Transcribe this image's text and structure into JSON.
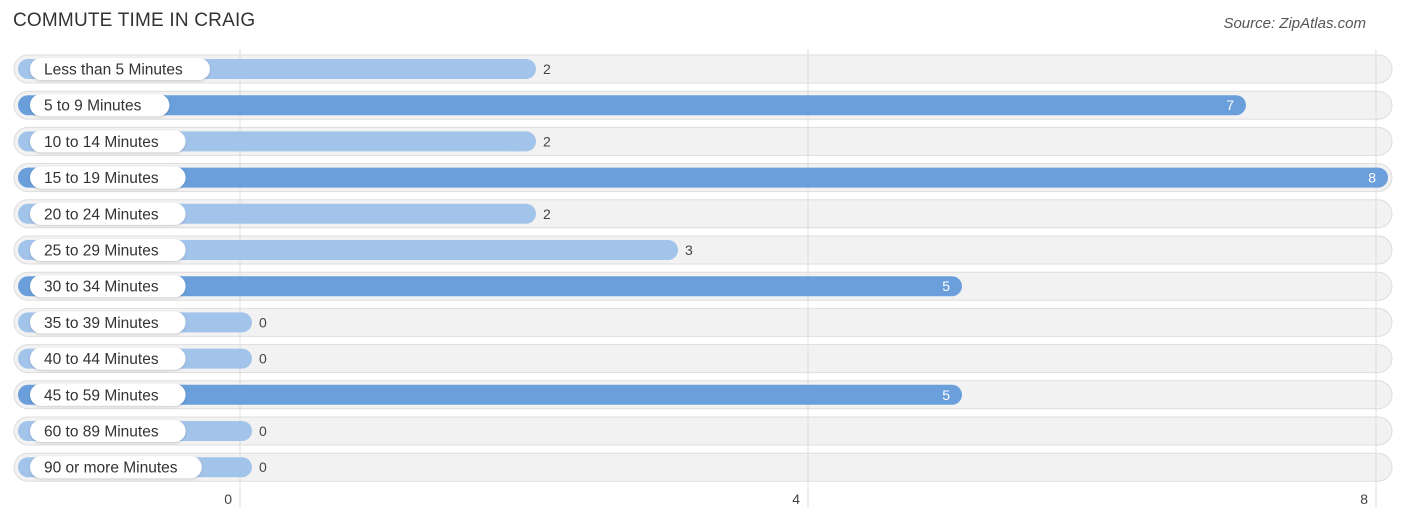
{
  "chart_data": {
    "type": "bar",
    "orientation": "horizontal",
    "title": "COMMUTE TIME IN CRAIG",
    "source": "Source: ZipAtlas.com",
    "categories": [
      "Less than 5 Minutes",
      "5 to 9 Minutes",
      "10 to 14 Minutes",
      "15 to 19 Minutes",
      "20 to 24 Minutes",
      "25 to 29 Minutes",
      "30 to 34 Minutes",
      "35 to 39 Minutes",
      "40 to 44 Minutes",
      "45 to 59 Minutes",
      "60 to 89 Minutes",
      "90 or more Minutes"
    ],
    "values": [
      2,
      7,
      2,
      8,
      2,
      3,
      5,
      0,
      0,
      5,
      0,
      0
    ],
    "xlabel": "",
    "ylabel": "",
    "xlim": [
      0,
      8
    ],
    "xticks": [
      0,
      4,
      8
    ],
    "xtick_labels": [
      "0",
      "4",
      "8"
    ],
    "grid": true,
    "legend": "none",
    "colors": {
      "bar_strong": "#6a9fdb",
      "bar_light": "#a3c4ea",
      "track": "#f2f2f2",
      "track_border": "#dddddd",
      "gridline": "#dddddd",
      "label_inside": "#ffffff",
      "label_outside": "#444444"
    }
  }
}
